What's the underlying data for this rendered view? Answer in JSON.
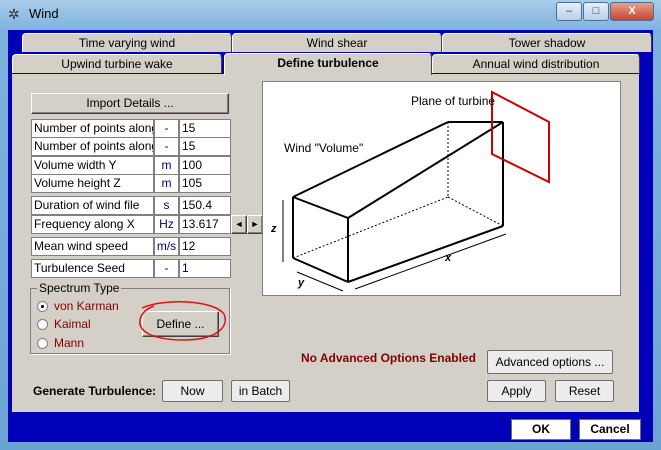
{
  "window": {
    "title": "Wind",
    "minimize": "–",
    "maximize": "□",
    "close": "X"
  },
  "tabs": {
    "row1": [
      "Time varying wind",
      "Wind shear",
      "Tower shadow"
    ],
    "row2": [
      "Upwind turbine wake",
      "Define turbulence",
      "Annual wind distribution"
    ],
    "active": "Define turbulence"
  },
  "import_button": "Import Details ...",
  "params": [
    {
      "label": "Number of points along Y",
      "unit": "-",
      "value": "15"
    },
    {
      "label": "Number of points along Z",
      "unit": "-",
      "value": "15"
    },
    {
      "label": "Volume width Y",
      "unit": "m",
      "value": "100"
    },
    {
      "label": "Volume height Z",
      "unit": "m",
      "value": "105"
    },
    {
      "label": "Duration of wind file",
      "unit": "s",
      "value": "150.4"
    },
    {
      "label": "Frequency along X",
      "unit": "Hz",
      "value": "13.617"
    },
    {
      "label": "Mean wind speed",
      "unit": "m/s",
      "value": "12"
    },
    {
      "label": "Turbulence Seed",
      "unit": "-",
      "value": "1"
    }
  ],
  "spinner": {
    "left": "◄",
    "right": "►"
  },
  "spectrum": {
    "title": "Spectrum Type",
    "options": [
      "von Karman",
      "Kaimal",
      "Mann"
    ],
    "selected": "von Karman",
    "define_button": "Define ..."
  },
  "diagram": {
    "plane_label": "Plane of turbine",
    "volume_label": "Wind \"Volume\"",
    "axis_z": "z",
    "axis_y": "y",
    "axis_x": "x"
  },
  "advanced": {
    "status": "No Advanced Options Enabled",
    "button": "Advanced options ..."
  },
  "generate": {
    "label": "Generate Turbulence:",
    "now": "Now",
    "batch": "in Batch"
  },
  "actions": {
    "apply": "Apply",
    "reset": "Reset",
    "ok": "OK",
    "cancel": "Cancel"
  },
  "colors": {
    "client_bg": "#0000b8",
    "panel_bg": "#d4d0c8",
    "turbine_plane": "#cc0000",
    "warning_text": "#800000",
    "annotation_circle": "#dd1111"
  }
}
